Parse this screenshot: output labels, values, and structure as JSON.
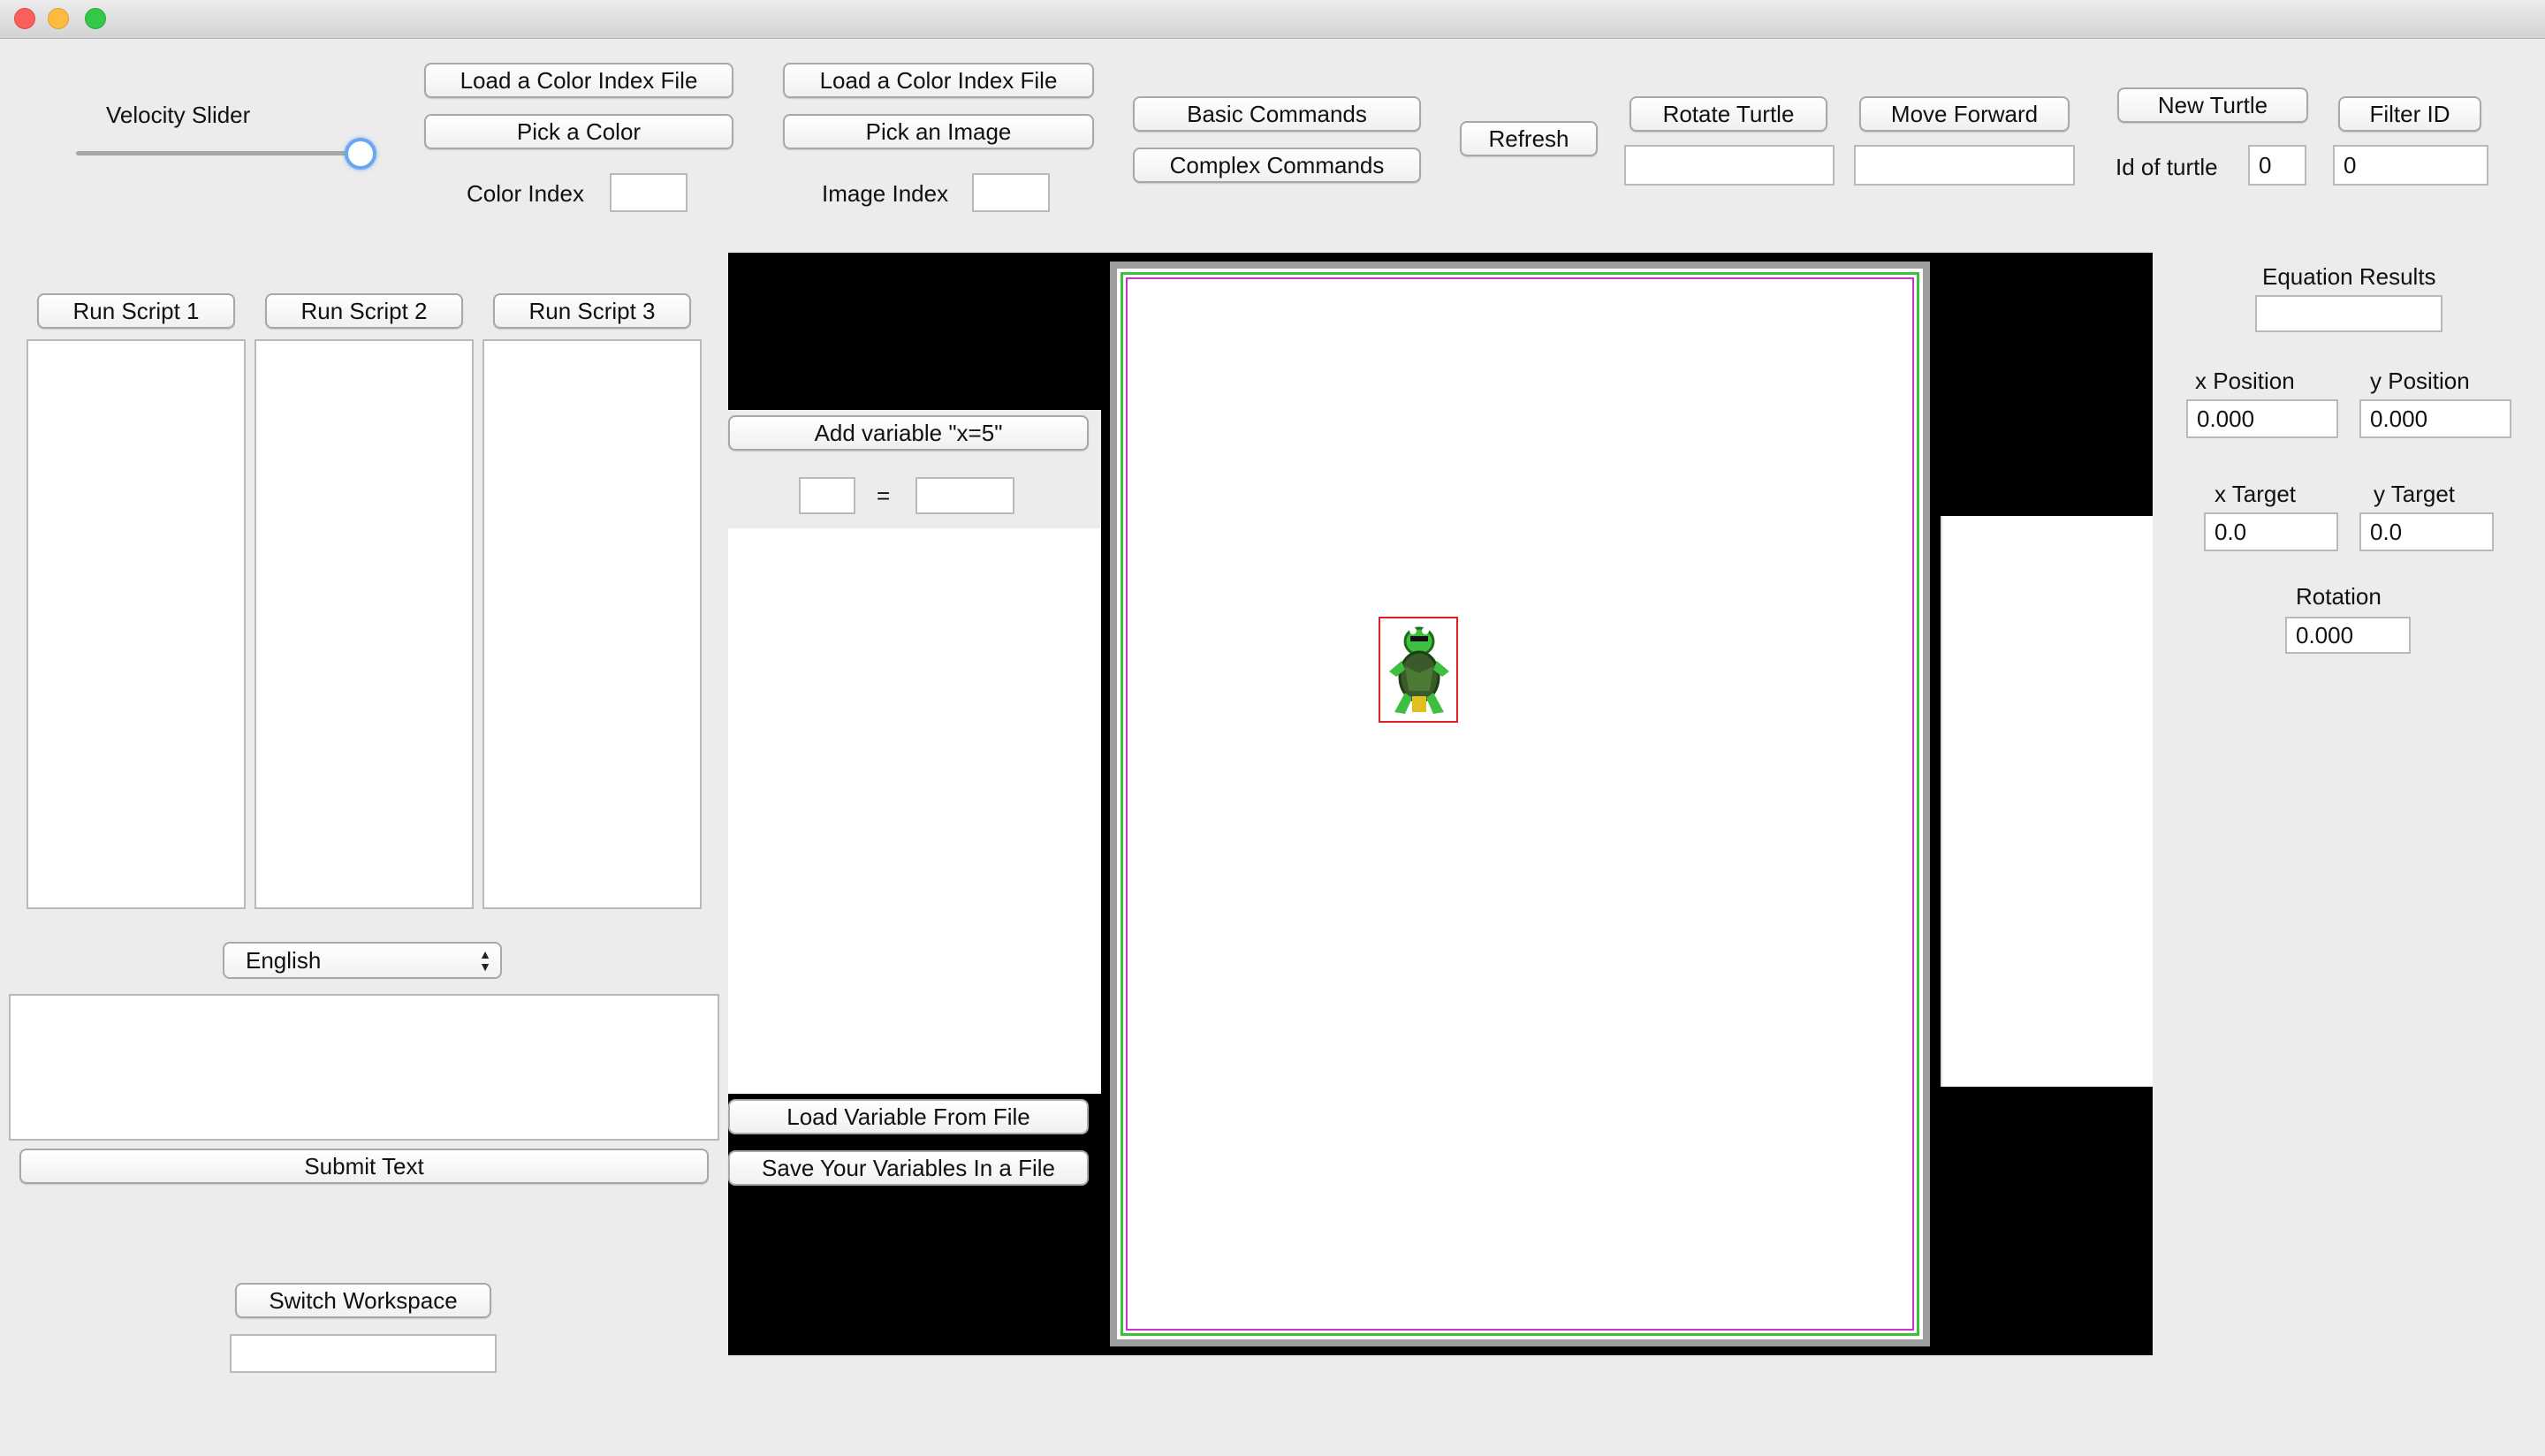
{
  "window": {
    "colors": {
      "close": "#fc605c",
      "minimize": "#fdbc40",
      "zoom": "#34c84a"
    }
  },
  "velocity": {
    "label": "Velocity Slider",
    "value_fraction": 1.0
  },
  "color_panel": {
    "load_label": "Load a Color Index File",
    "pick_label": "Pick a Color",
    "index_label": "Color Index",
    "index_value": ""
  },
  "image_panel": {
    "load_label": "Load a Color Index File",
    "pick_label": "Pick an Image",
    "index_label": "Image Index",
    "index_value": ""
  },
  "commands": {
    "basic_label": "Basic Commands",
    "complex_label": "Complex Commands",
    "refresh_label": "Refresh",
    "rotate_label": "Rotate Turtle",
    "rotate_value": "",
    "move_label": "Move Forward",
    "move_value": "",
    "new_turtle_label": "New Turtle",
    "filter_label": "Filter ID",
    "id_label": "Id of turtle",
    "id_value": "0",
    "filter_value": "0"
  },
  "scripts": [
    {
      "label": "Run Script 1",
      "content": ""
    },
    {
      "label": "Run Script 2",
      "content": ""
    },
    {
      "label": "Run Script 3",
      "content": ""
    }
  ],
  "language": {
    "selected": "English"
  },
  "console": {
    "text": "",
    "submit_label": "Submit Text"
  },
  "workspace": {
    "switch_label": "Switch Workspace",
    "value": ""
  },
  "variables": {
    "add_label": "Add variable \"x=5\"",
    "name_value": "",
    "equals": "=",
    "value_value": "",
    "load_label": "Load Variable From File",
    "save_label": "Save Your Variables In a File"
  },
  "canvas": {
    "background": "#000000",
    "border_colors": [
      "#9e9e9e",
      "#3fbf3f",
      "#cc33cc"
    ],
    "turtle_color": "#3fbf3f",
    "selection_color": "#e02020"
  },
  "info": {
    "equation_label": "Equation Results",
    "equation_value": "",
    "x_position_label": "x Position",
    "x_position_value": "0.000",
    "y_position_label": "y Position",
    "y_position_value": "0.000",
    "x_target_label": "x Target",
    "x_target_value": "0.0",
    "y_target_label": "y Target",
    "y_target_value": "0.0",
    "rotation_label": "Rotation",
    "rotation_value": "0.000"
  }
}
